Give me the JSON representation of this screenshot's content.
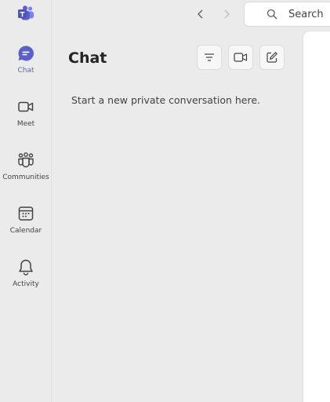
{
  "rail": {
    "items": [
      {
        "id": "chat",
        "label": "Chat",
        "icon": "chat-icon",
        "active": true
      },
      {
        "id": "meet",
        "label": "Meet",
        "icon": "video-camera-icon",
        "active": false
      },
      {
        "id": "communities",
        "label": "Communities",
        "icon": "communities-icon",
        "active": false
      },
      {
        "id": "calendar",
        "label": "Calendar",
        "icon": "calendar-icon",
        "active": false
      },
      {
        "id": "activity",
        "label": "Activity",
        "icon": "bell-icon",
        "active": false
      }
    ]
  },
  "topbar": {
    "search_placeholder": "Search"
  },
  "chat_pane": {
    "title": "Chat",
    "empty_message": "Start a new private conversation here."
  },
  "colors": {
    "accent": "#5b5fc7",
    "rail_background": "#ebebeb",
    "main_background": "#ffffff"
  }
}
